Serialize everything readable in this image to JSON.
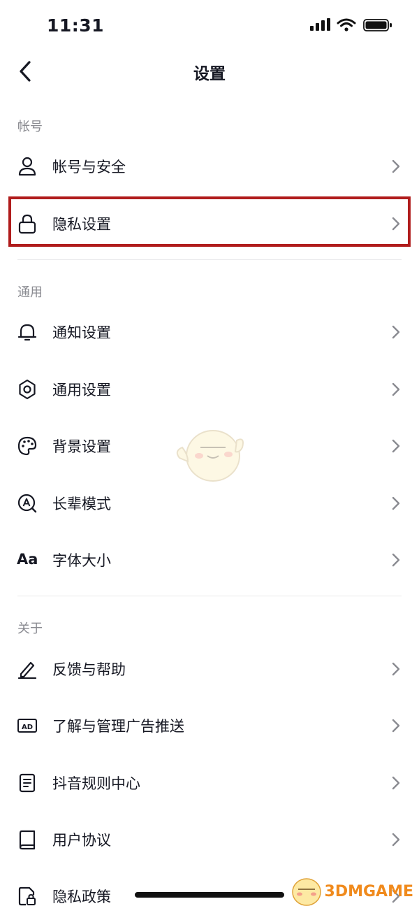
{
  "status_bar": {
    "time": "11:31"
  },
  "nav": {
    "title": "设置"
  },
  "sections": {
    "account": {
      "label": "帐号"
    },
    "general": {
      "label": "通用"
    },
    "about": {
      "label": "关于"
    }
  },
  "items": {
    "account_security": "帐号与安全",
    "privacy_settings": "隐私设置",
    "notification_settings": "通知设置",
    "general_settings": "通用设置",
    "background_settings": "背景设置",
    "elder_mode": "长辈模式",
    "font_size": "字体大小",
    "feedback_help": "反馈与帮助",
    "ad_management": "了解与管理广告推送",
    "rules_center": "抖音规则中心",
    "user_agreement": "用户协议",
    "privacy_policy": "隐私政策"
  },
  "icons": {
    "font_size_glyph": "Aa",
    "ad_glyph": "AD"
  },
  "watermark": {
    "text": "3DMGAME"
  },
  "colors": {
    "highlight_border": "#b01c1c",
    "watermark": "#f08a1c"
  }
}
